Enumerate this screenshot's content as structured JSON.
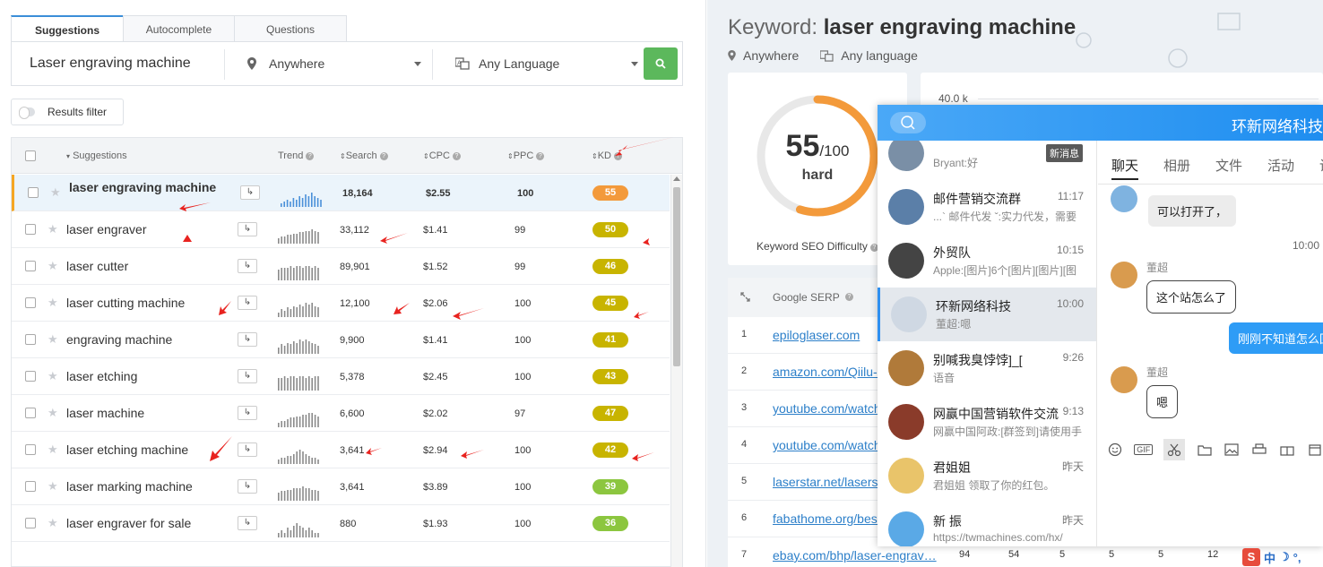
{
  "tabs": [
    {
      "label": "Suggestions",
      "active": true
    },
    {
      "label": "Autocomplete",
      "active": false
    },
    {
      "label": "Questions",
      "active": false
    }
  ],
  "search": {
    "keyword": "Laser engraving machine",
    "location": "Anywhere",
    "language": "Any Language"
  },
  "filter": {
    "label": "Results filter"
  },
  "table": {
    "columns": {
      "suggestions": "Suggestions",
      "trend": "Trend",
      "search": "Search",
      "cpc": "CPC",
      "ppc": "PPC",
      "kd": "KD"
    },
    "rows": [
      {
        "keyword": "laser engraving machine",
        "search": "18,164",
        "cpc": "$2.55",
        "ppc": "100",
        "kd": "55",
        "kd_color": "#f39a3b",
        "selected": true,
        "trend": [
          2,
          3,
          4,
          3,
          5,
          4,
          6,
          5,
          7,
          6,
          8,
          6,
          5,
          4
        ]
      },
      {
        "keyword": "laser engraver",
        "search": "33,112",
        "cpc": "$1.41",
        "ppc": "99",
        "kd": "50",
        "kd_color": "#c8b400",
        "selected": false,
        "trend": [
          4,
          5,
          5,
          6,
          6,
          7,
          7,
          8,
          8,
          9,
          9,
          10,
          9,
          8
        ]
      },
      {
        "keyword": "laser cutter",
        "search": "89,901",
        "cpc": "$1.52",
        "ppc": "99",
        "kd": "46",
        "kd_color": "#c8b400",
        "selected": false,
        "trend": [
          7,
          8,
          8,
          8,
          9,
          8,
          9,
          9,
          8,
          9,
          9,
          8,
          9,
          8
        ]
      },
      {
        "keyword": "laser cutting machine",
        "search": "12,100",
        "cpc": "$2.06",
        "ppc": "100",
        "kd": "45",
        "kd_color": "#c8b400",
        "selected": false,
        "trend": [
          3,
          5,
          4,
          6,
          5,
          7,
          6,
          8,
          7,
          9,
          8,
          9,
          7,
          6
        ]
      },
      {
        "keyword": "engraving machine",
        "search": "9,900",
        "cpc": "$1.41",
        "ppc": "100",
        "kd": "41",
        "kd_color": "#c8b400",
        "selected": false,
        "trend": [
          4,
          6,
          5,
          7,
          6,
          8,
          7,
          9,
          8,
          9,
          8,
          7,
          6,
          5
        ]
      },
      {
        "keyword": "laser etching",
        "search": "5,378",
        "cpc": "$2.45",
        "ppc": "100",
        "kd": "43",
        "kd_color": "#c8b400",
        "selected": false,
        "trend": [
          8,
          8,
          9,
          8,
          9,
          9,
          8,
          9,
          9,
          8,
          9,
          8,
          9,
          9
        ]
      },
      {
        "keyword": "laser machine",
        "search": "6,600",
        "cpc": "$2.02",
        "ppc": "97",
        "kd": "47",
        "kd_color": "#c8b400",
        "selected": false,
        "trend": [
          3,
          4,
          4,
          5,
          6,
          6,
          7,
          7,
          8,
          8,
          9,
          9,
          8,
          7
        ]
      },
      {
        "keyword": "laser etching machine",
        "search": "3,641",
        "cpc": "$2.94",
        "ppc": "100",
        "kd": "42",
        "kd_color": "#c8b400",
        "selected": false,
        "trend": [
          2,
          3,
          3,
          4,
          4,
          5,
          6,
          7,
          6,
          5,
          4,
          3,
          3,
          2
        ]
      },
      {
        "keyword": "laser marking machine",
        "search": "3,641",
        "cpc": "$3.89",
        "ppc": "100",
        "kd": "39",
        "kd_color": "#8cc63f",
        "selected": false,
        "trend": [
          5,
          6,
          6,
          7,
          7,
          8,
          8,
          8,
          9,
          8,
          8,
          7,
          7,
          6
        ]
      },
      {
        "keyword": "laser engraver for sale",
        "search": "880",
        "cpc": "$1.93",
        "ppc": "100",
        "kd": "36",
        "kd_color": "#8cc63f",
        "selected": false,
        "trend": [
          2,
          3,
          2,
          4,
          3,
          5,
          6,
          5,
          4,
          3,
          4,
          3,
          2,
          2
        ]
      }
    ]
  },
  "right": {
    "title_label": "Keyword:",
    "title_keyword": "laser engraving machine",
    "location": "Anywhere",
    "language": "Any language",
    "kd_value": "55",
    "kd_max": "/100",
    "kd_fraction": 0.55,
    "kd_word": "hard",
    "kd_caption": "Keyword SEO Difficulty",
    "chart_tick": "40.0 k",
    "serp_header": "Google SERP",
    "serp": [
      {
        "idx": "1",
        "url": "epiloglaser.com",
        "m": []
      },
      {
        "idx": "2",
        "url": "amazon.com/Qiilu-…",
        "m": []
      },
      {
        "idx": "3",
        "url": "youtube.com/watch",
        "m": []
      },
      {
        "idx": "4",
        "url": "youtube.com/watch",
        "m": []
      },
      {
        "idx": "5",
        "url": "laserstar.net/lasers",
        "m": []
      },
      {
        "idx": "6",
        "url": "fabathome.org/best",
        "m": []
      },
      {
        "idx": "7",
        "url": "ebay.com/bhp/laser-engrav…",
        "m": [
          "94",
          "54",
          "5",
          "5",
          "5",
          "12"
        ]
      }
    ]
  },
  "chat": {
    "title": "环新网络科技",
    "new_msg_tag": "新消息",
    "conversations": [
      {
        "name": "",
        "time": "",
        "preview": "Bryant:好",
        "avatar_color": "#7a8fa6",
        "selected": false
      },
      {
        "name": "邮件营销交流群",
        "time": "11:17",
        "preview": "...` 邮件代发 ˇ:实力代发，需要",
        "avatar_color": "#5b7fa8",
        "selected": false
      },
      {
        "name": "外贸队",
        "time": "10:15",
        "preview": "Apple:[图片]6个[图片][图片][图",
        "avatar_color": "#444444",
        "selected": false
      },
      {
        "name": "环新网络科技",
        "time": "10:00",
        "preview": "董超:嗯",
        "avatar_color": "#cfd8e3",
        "selected": true
      },
      {
        "name": "别喊我臭饽饽]_[",
        "time": "9:26",
        "preview": "语音",
        "avatar_color": "#b07a3a",
        "selected": false
      },
      {
        "name": "网赢中国营销软件交流",
        "time": "9:13",
        "preview": "网赢中国阿政:[群签到]请使用手",
        "avatar_color": "#8a3b2a",
        "selected": false
      },
      {
        "name": "君姐姐",
        "time": "昨天",
        "preview": "君姐姐   领取了你的红包。",
        "avatar_color": "#e9c46a",
        "selected": false
      },
      {
        "name": "新  振",
        "time": "昨天",
        "preview": "https://twmachines.com/hx/",
        "avatar_color": "#5aa9e6",
        "selected": false
      }
    ],
    "tabs": [
      "聊天",
      "相册",
      "文件",
      "活动",
      "设"
    ],
    "messages": {
      "m1": "可以打开了，",
      "time": "10:00",
      "sender": "董超",
      "m2": "这个站怎么了",
      "m3": "刚刚不知道怎么回",
      "sender2": "董超",
      "m4": "嗯"
    },
    "toolbar": [
      "emoji-icon",
      "gif-icon",
      "scissors-icon",
      "folder-icon",
      "image-icon",
      "printer-icon",
      "gift-icon",
      "calendar-icon"
    ],
    "gif_label": "GIF"
  },
  "ime": {
    "s": "S",
    "lang": "中"
  },
  "colors": {
    "accent": "#3b8ed8",
    "go_green": "#5cb85c",
    "kd_ring": "#f39a3b",
    "link": "#2c7fc9"
  }
}
